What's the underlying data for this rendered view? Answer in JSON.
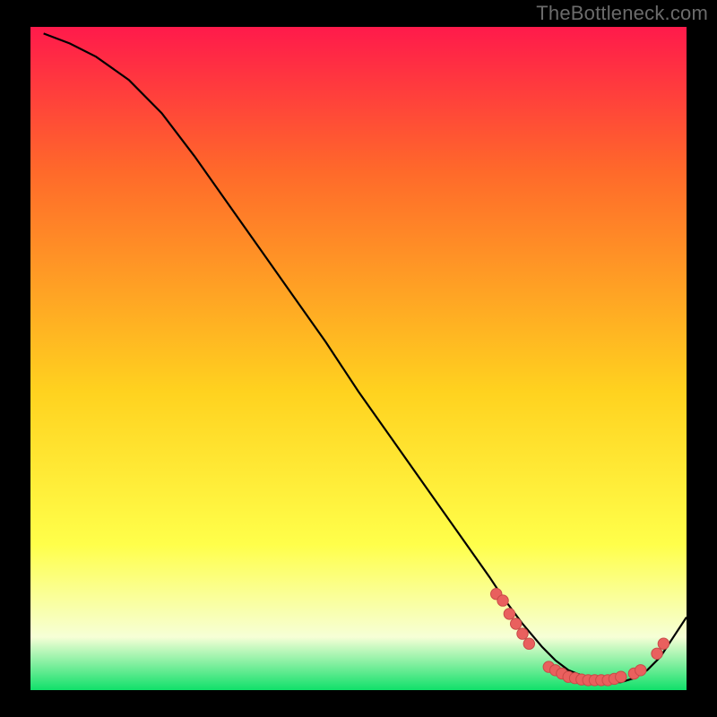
{
  "watermark": "TheBottleneck.com",
  "colors": {
    "gradient_top": "#ff1a4b",
    "gradient_mid1": "#ff6a2a",
    "gradient_mid2": "#ffd21f",
    "gradient_mid3": "#ffff4a",
    "gradient_bottom_pale": "#f6ffd6",
    "gradient_bottom_green": "#10e06a",
    "curve": "#000000",
    "marker_fill": "#e9605e",
    "marker_stroke": "#c94a48",
    "frame": "#000000"
  },
  "chart_data": {
    "type": "line",
    "title": "",
    "xlabel": "",
    "ylabel": "",
    "xlim": [
      0,
      100
    ],
    "ylim": [
      0,
      100
    ],
    "series": [
      {
        "name": "curve",
        "x": [
          2,
          6,
          10,
          15,
          20,
          25,
          30,
          35,
          40,
          45,
          50,
          55,
          60,
          65,
          70,
          72,
          75,
          78,
          80,
          82,
          85,
          88,
          90,
          92,
          94,
          96,
          98,
          100
        ],
        "y": [
          99,
          97.5,
          95.5,
          92,
          87,
          80.5,
          73.5,
          66.5,
          59.5,
          52.5,
          45,
          38,
          31,
          24,
          17,
          14,
          10,
          6.5,
          4.5,
          3,
          1.8,
          1.2,
          1.2,
          1.8,
          3,
          5,
          8,
          11
        ]
      }
    ],
    "markers": [
      {
        "x": 71,
        "y": 14.5
      },
      {
        "x": 72,
        "y": 13.5
      },
      {
        "x": 73,
        "y": 11.5
      },
      {
        "x": 74,
        "y": 10
      },
      {
        "x": 75,
        "y": 8.5
      },
      {
        "x": 76,
        "y": 7
      },
      {
        "x": 79,
        "y": 3.5
      },
      {
        "x": 80,
        "y": 3
      },
      {
        "x": 81,
        "y": 2.5
      },
      {
        "x": 82,
        "y": 2
      },
      {
        "x": 83,
        "y": 1.8
      },
      {
        "x": 84,
        "y": 1.6
      },
      {
        "x": 85,
        "y": 1.5
      },
      {
        "x": 86,
        "y": 1.5
      },
      {
        "x": 87,
        "y": 1.5
      },
      {
        "x": 88,
        "y": 1.5
      },
      {
        "x": 89,
        "y": 1.7
      },
      {
        "x": 90,
        "y": 2
      },
      {
        "x": 92,
        "y": 2.5
      },
      {
        "x": 93,
        "y": 3
      },
      {
        "x": 95.5,
        "y": 5.5
      },
      {
        "x": 96.5,
        "y": 7
      }
    ]
  }
}
